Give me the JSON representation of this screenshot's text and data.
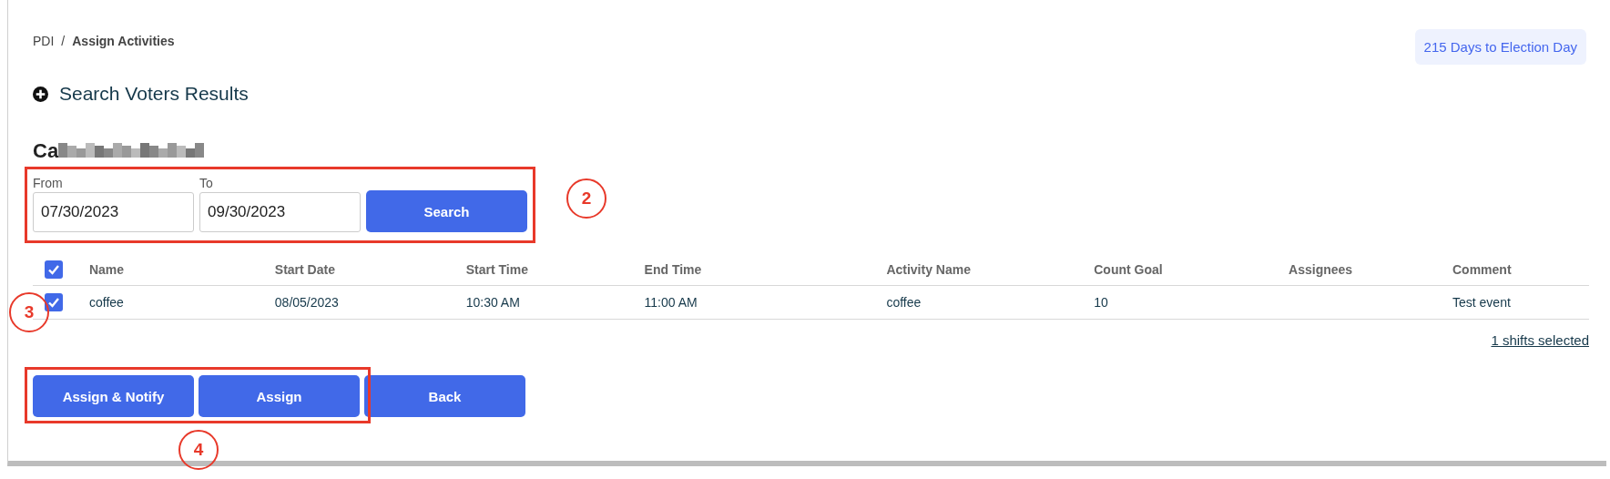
{
  "breadcrumb": {
    "root": "PDI",
    "separator": "/",
    "current": "Assign Activities"
  },
  "countdown_badge": "215 Days to Election Day",
  "section_toggle": {
    "label": "Search Voters Results",
    "expanded": false
  },
  "person_name": "Ca",
  "date_filter": {
    "from_label": "From",
    "from_value": "07/30/2023",
    "to_label": "To",
    "to_value": "09/30/2023",
    "search_button": "Search"
  },
  "table": {
    "all_checked": true,
    "columns": [
      "Name",
      "Start Date",
      "Start Time",
      "End Time",
      "Activity Name",
      "Count Goal",
      "Assignees",
      "Comment"
    ],
    "rows": [
      {
        "selected": true,
        "cells": [
          "coffee",
          "08/05/2023",
          "10:30 AM",
          "11:00 AM",
          "coffee",
          "10",
          "",
          "Test event"
        ]
      }
    ]
  },
  "selection_summary": "1 shifts selected",
  "buttons": [
    "Assign & Notify",
    "Assign",
    "Back"
  ],
  "annotations": [
    "2",
    "3",
    "4"
  ]
}
